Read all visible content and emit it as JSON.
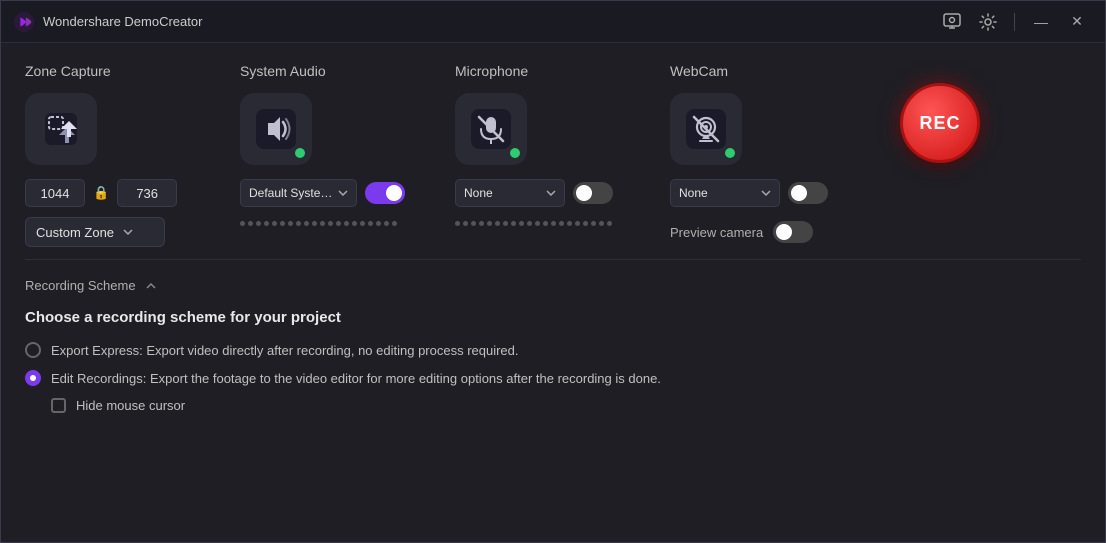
{
  "app": {
    "title": "Wondershare DemoCreator",
    "logo_color": "#a020f0"
  },
  "titlebar": {
    "minimize_label": "—",
    "close_label": "✕"
  },
  "sections": {
    "zone_capture": {
      "title": "Zone Capture",
      "width_value": "1044",
      "height_value": "736",
      "zone_dropdown_label": "Custom Zone"
    },
    "system_audio": {
      "title": "System Audio",
      "dropdown_label": "Default Syste…",
      "toggle_on": true
    },
    "microphone": {
      "title": "Microphone",
      "dropdown_label": "None",
      "toggle_on": false
    },
    "webcam": {
      "title": "WebCam",
      "dropdown_label": "None",
      "toggle_on": false,
      "preview_camera_label": "Preview camera",
      "preview_toggle_on": false
    }
  },
  "rec_button": {
    "label": "REC"
  },
  "recording_scheme": {
    "bar_label": "Recording Scheme",
    "title": "Choose a recording scheme for your project",
    "options": [
      {
        "id": "export_express",
        "label": "Export Express: Export video directly after recording, no editing process required.",
        "selected": false
      },
      {
        "id": "edit_recordings",
        "label": "Edit Recordings: Export the footage to the video editor for more editing options after the recording is done.",
        "selected": true
      }
    ],
    "checkbox": {
      "label": "Hide mouse cursor",
      "checked": false
    }
  }
}
